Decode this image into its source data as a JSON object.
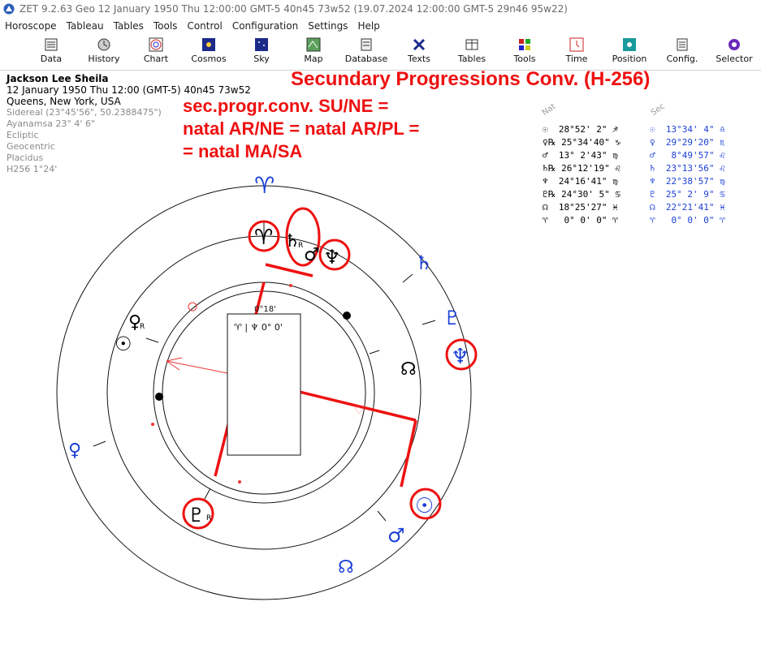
{
  "window": {
    "title": "ZET 9.2.63 Geo    12 January 1950  Thu  12:00:00 GMT-5 40n45  73w52  (19.07.2024  12:00:00 GMT-5 29n46 95w22)"
  },
  "menu": [
    "Horoscope",
    "Tableau",
    "Tables",
    "Tools",
    "Control",
    "Configuration",
    "Settings",
    "Help"
  ],
  "toolbar": [
    {
      "label": "Data",
      "icon": "data-icon"
    },
    {
      "label": "History",
      "icon": "history-icon"
    },
    {
      "label": "Chart",
      "icon": "chart-icon"
    },
    {
      "label": "Cosmos",
      "icon": "cosmos-icon"
    },
    {
      "label": "Sky",
      "icon": "sky-icon"
    },
    {
      "label": "Map",
      "icon": "map-icon"
    },
    {
      "label": "Database",
      "icon": "database-icon"
    },
    {
      "label": "Texts",
      "icon": "texts-icon"
    },
    {
      "label": "Tables",
      "icon": "tables-icon"
    },
    {
      "label": "Tools",
      "icon": "tools-icon"
    },
    {
      "label": "Time",
      "icon": "time-icon"
    },
    {
      "label": "Position",
      "icon": "position-icon"
    },
    {
      "label": "Config.",
      "icon": "config-icon"
    },
    {
      "label": "Selector",
      "icon": "selector-icon"
    }
  ],
  "person": {
    "name": "Jackson Lee Sheila",
    "datetime": "12 January 1950  Thu   12:00 (GMT-5)  40n45   73w52",
    "place": "Queens, New York, USA",
    "settings": [
      "Sidereal (23°45'56\", 50.2388475\")",
      "Ayanamsa 23° 4' 6\"",
      "Ecliptic",
      "Geocentric",
      "Placidus",
      "H256    1°24'"
    ]
  },
  "annotation": {
    "title": "Secundary Progressions Conv. (H-256)",
    "formula_1": "sec.progr.conv. SU/NE =",
    "formula_2": "natal AR/NE = natal AR/PL =",
    "formula_3": "= natal MA/SA"
  },
  "table": {
    "natal_header": "Nat",
    "sec_header": "Sec",
    "natal_rows": [
      "☉  28°52' 2\" ♐",
      "♀℞ 25°34'40\" ♑",
      "♂  13° 2'43\" ♍",
      "♄℞ 26°12'19\" ♌",
      "♆  24°16'41\" ♍",
      "♇℞ 24°30' 5\" ♋",
      "☊  18°25'27\" ♓",
      "♈   0° 0' 0\" ♈"
    ],
    "sec_rows": [
      "☉  13°34' 4\" ♎",
      "♀  29°29'20\" ♏",
      "♂   8°49'57\" ♌",
      "♄  23°13'56\" ♌",
      "♆  22°38'57\" ♍",
      "♇  25° 2' 9\" ♋",
      "☊  22°21'41\" ♓",
      "♈   0° 0' 0\" ♈"
    ]
  },
  "wheel": {
    "inner_box_label": "♈ | ♆   0° 0'",
    "inner_degree": "0°18'",
    "colors": {
      "natal": "#000000",
      "secondary": "#1a3fd8",
      "highlight": "#ee1111"
    }
  }
}
